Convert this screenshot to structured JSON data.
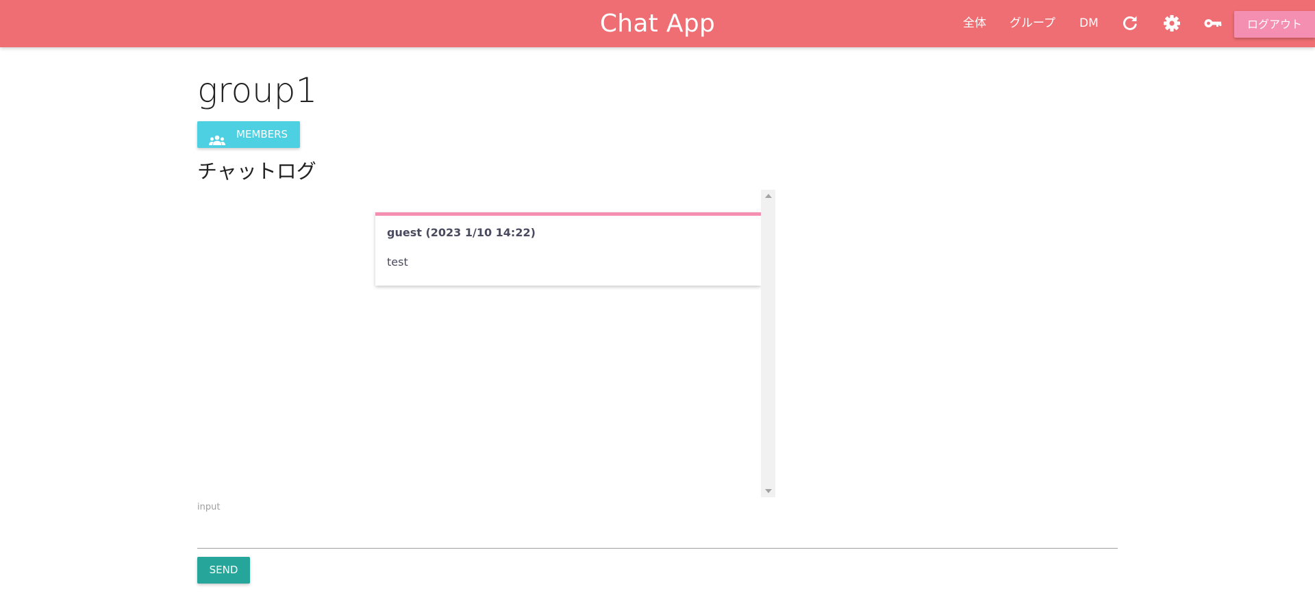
{
  "header": {
    "brand": "Chat App",
    "nav": {
      "all": "全体",
      "group": "グループ",
      "dm": "DM"
    },
    "icons": {
      "refresh": "refresh-icon",
      "settings": "gear-icon",
      "key": "key-icon"
    },
    "logout_label": "ログアウト"
  },
  "page": {
    "title": "group1",
    "members_label": "MEMBERS",
    "members_icon": "group-icon",
    "section_title": "チャットログ"
  },
  "chat": {
    "messages": [
      {
        "author_line": "guest (2023 1/10 14:22)",
        "text": "test"
      }
    ]
  },
  "composer": {
    "label": "input",
    "value": "",
    "send_label": "SEND"
  },
  "colors": {
    "navbar": "#ef6e73",
    "logout": "#f48fb1",
    "members": "#4dd0e1",
    "send": "#26a69a",
    "card_accent": "#f48fb1"
  }
}
